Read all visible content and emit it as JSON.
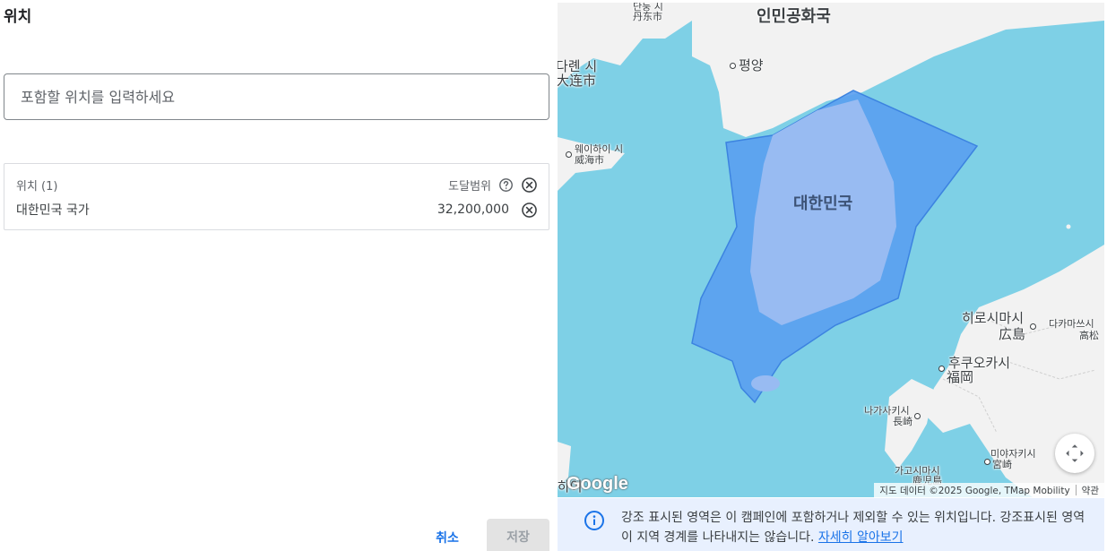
{
  "panel": {
    "title": "위치",
    "search_placeholder": "포함할 위치를 입력하세요",
    "table": {
      "header_label": "위치 (1)",
      "reach_label": "도달범위",
      "items": [
        {
          "name": "대한민국 국가",
          "reach": "32,200,000"
        }
      ]
    },
    "cancel_label": "취소",
    "save_label": "저장"
  },
  "map": {
    "labels": {
      "dandong": "丹东市",
      "dandong_kr": "단둥 시",
      "prc": "인민공화국",
      "pyongyang": "평양",
      "dalian_kr": "다롄 시",
      "dalian_cn": "大连市",
      "weihai_kr": "웨이하이 시",
      "weihai_cn": "威海市",
      "korea": "대한민국",
      "hiroshima_kr": "히로시마시",
      "hiroshima_jp": "広島",
      "takamatsu_kr": "다카마쓰시",
      "takamatsu_jp": "高松",
      "fukuoka_kr": "후쿠오카시",
      "fukuoka_jp": "福岡",
      "nagasaki_kr": "나가사키시",
      "nagasaki_jp": "長崎",
      "miyazaki_kr": "미야자키시",
      "miyazaki_jp": "宮崎",
      "kagoshima_kr": "가고시마시",
      "kagoshima_jp": "鹿児島",
      "shanghai_kr": "하이"
    },
    "google_logo": "Google",
    "attribution": "지도 데이터 ©2025 Google, TMap Mobility",
    "terms": "약관",
    "colors": {
      "sea": "#7ed0e6",
      "land": "#f2f2f2",
      "highlight": "#5a9ff0",
      "highlight_land": "#98bbf2"
    }
  },
  "info": {
    "text": "강조 표시된 영역은 이 캠페인에 포함하거나 제외할 수 있는 위치입니다. 강조표시된 영역이 지역 경계를 나타내지는 않습니다.",
    "link": "자세히 알아보기"
  }
}
